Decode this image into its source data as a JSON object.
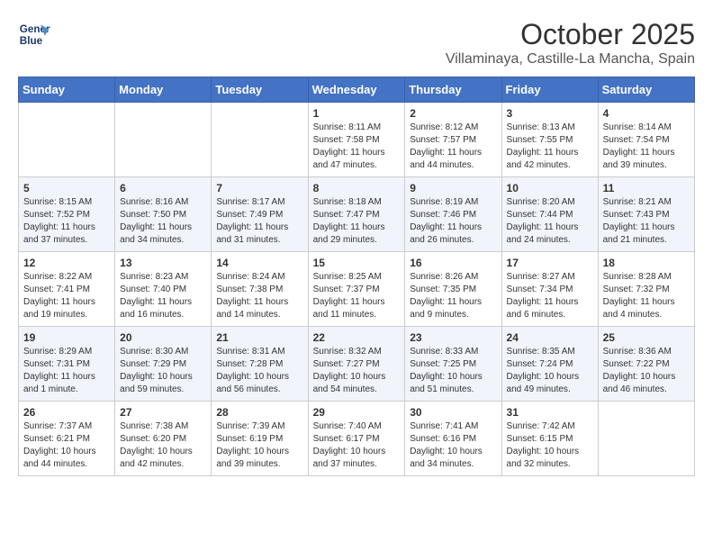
{
  "header": {
    "logo_line1": "General",
    "logo_line2": "Blue",
    "month_title": "October 2025",
    "location": "Villaminaya, Castille-La Mancha, Spain"
  },
  "weekdays": [
    "Sunday",
    "Monday",
    "Tuesday",
    "Wednesday",
    "Thursday",
    "Friday",
    "Saturday"
  ],
  "weeks": [
    [
      {
        "day": "",
        "info": ""
      },
      {
        "day": "",
        "info": ""
      },
      {
        "day": "",
        "info": ""
      },
      {
        "day": "1",
        "info": "Sunrise: 8:11 AM\nSunset: 7:58 PM\nDaylight: 11 hours\nand 47 minutes."
      },
      {
        "day": "2",
        "info": "Sunrise: 8:12 AM\nSunset: 7:57 PM\nDaylight: 11 hours\nand 44 minutes."
      },
      {
        "day": "3",
        "info": "Sunrise: 8:13 AM\nSunset: 7:55 PM\nDaylight: 11 hours\nand 42 minutes."
      },
      {
        "day": "4",
        "info": "Sunrise: 8:14 AM\nSunset: 7:54 PM\nDaylight: 11 hours\nand 39 minutes."
      }
    ],
    [
      {
        "day": "5",
        "info": "Sunrise: 8:15 AM\nSunset: 7:52 PM\nDaylight: 11 hours\nand 37 minutes."
      },
      {
        "day": "6",
        "info": "Sunrise: 8:16 AM\nSunset: 7:50 PM\nDaylight: 11 hours\nand 34 minutes."
      },
      {
        "day": "7",
        "info": "Sunrise: 8:17 AM\nSunset: 7:49 PM\nDaylight: 11 hours\nand 31 minutes."
      },
      {
        "day": "8",
        "info": "Sunrise: 8:18 AM\nSunset: 7:47 PM\nDaylight: 11 hours\nand 29 minutes."
      },
      {
        "day": "9",
        "info": "Sunrise: 8:19 AM\nSunset: 7:46 PM\nDaylight: 11 hours\nand 26 minutes."
      },
      {
        "day": "10",
        "info": "Sunrise: 8:20 AM\nSunset: 7:44 PM\nDaylight: 11 hours\nand 24 minutes."
      },
      {
        "day": "11",
        "info": "Sunrise: 8:21 AM\nSunset: 7:43 PM\nDaylight: 11 hours\nand 21 minutes."
      }
    ],
    [
      {
        "day": "12",
        "info": "Sunrise: 8:22 AM\nSunset: 7:41 PM\nDaylight: 11 hours\nand 19 minutes."
      },
      {
        "day": "13",
        "info": "Sunrise: 8:23 AM\nSunset: 7:40 PM\nDaylight: 11 hours\nand 16 minutes."
      },
      {
        "day": "14",
        "info": "Sunrise: 8:24 AM\nSunset: 7:38 PM\nDaylight: 11 hours\nand 14 minutes."
      },
      {
        "day": "15",
        "info": "Sunrise: 8:25 AM\nSunset: 7:37 PM\nDaylight: 11 hours\nand 11 minutes."
      },
      {
        "day": "16",
        "info": "Sunrise: 8:26 AM\nSunset: 7:35 PM\nDaylight: 11 hours\nand 9 minutes."
      },
      {
        "day": "17",
        "info": "Sunrise: 8:27 AM\nSunset: 7:34 PM\nDaylight: 11 hours\nand 6 minutes."
      },
      {
        "day": "18",
        "info": "Sunrise: 8:28 AM\nSunset: 7:32 PM\nDaylight: 11 hours\nand 4 minutes."
      }
    ],
    [
      {
        "day": "19",
        "info": "Sunrise: 8:29 AM\nSunset: 7:31 PM\nDaylight: 11 hours\nand 1 minute."
      },
      {
        "day": "20",
        "info": "Sunrise: 8:30 AM\nSunset: 7:29 PM\nDaylight: 10 hours\nand 59 minutes."
      },
      {
        "day": "21",
        "info": "Sunrise: 8:31 AM\nSunset: 7:28 PM\nDaylight: 10 hours\nand 56 minutes."
      },
      {
        "day": "22",
        "info": "Sunrise: 8:32 AM\nSunset: 7:27 PM\nDaylight: 10 hours\nand 54 minutes."
      },
      {
        "day": "23",
        "info": "Sunrise: 8:33 AM\nSunset: 7:25 PM\nDaylight: 10 hours\nand 51 minutes."
      },
      {
        "day": "24",
        "info": "Sunrise: 8:35 AM\nSunset: 7:24 PM\nDaylight: 10 hours\nand 49 minutes."
      },
      {
        "day": "25",
        "info": "Sunrise: 8:36 AM\nSunset: 7:22 PM\nDaylight: 10 hours\nand 46 minutes."
      }
    ],
    [
      {
        "day": "26",
        "info": "Sunrise: 7:37 AM\nSunset: 6:21 PM\nDaylight: 10 hours\nand 44 minutes."
      },
      {
        "day": "27",
        "info": "Sunrise: 7:38 AM\nSunset: 6:20 PM\nDaylight: 10 hours\nand 42 minutes."
      },
      {
        "day": "28",
        "info": "Sunrise: 7:39 AM\nSunset: 6:19 PM\nDaylight: 10 hours\nand 39 minutes."
      },
      {
        "day": "29",
        "info": "Sunrise: 7:40 AM\nSunset: 6:17 PM\nDaylight: 10 hours\nand 37 minutes."
      },
      {
        "day": "30",
        "info": "Sunrise: 7:41 AM\nSunset: 6:16 PM\nDaylight: 10 hours\nand 34 minutes."
      },
      {
        "day": "31",
        "info": "Sunrise: 7:42 AM\nSunset: 6:15 PM\nDaylight: 10 hours\nand 32 minutes."
      },
      {
        "day": "",
        "info": ""
      }
    ]
  ]
}
